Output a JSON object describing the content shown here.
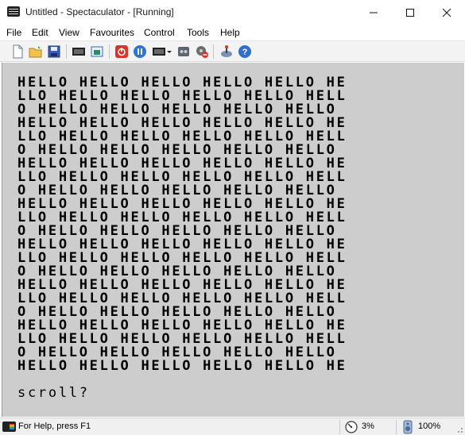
{
  "window": {
    "title": "Untitled - Spectaculator - [Running]"
  },
  "menu": [
    "File",
    "Edit",
    "View",
    "Favourites",
    "Control",
    "Tools",
    "Help"
  ],
  "toolbar": {
    "buttons": [
      {
        "name": "new-icon",
        "tooltip": ""
      },
      {
        "name": "open-folder-icon",
        "tooltip": ""
      },
      {
        "name": "save-icon",
        "tooltip": ""
      },
      {
        "name": "keyboard-icon",
        "tooltip": ""
      },
      {
        "name": "fullscreen-icon",
        "tooltip": ""
      },
      {
        "name": "power-icon",
        "tooltip": ""
      },
      {
        "name": "pause-icon",
        "tooltip": ""
      },
      {
        "name": "keyboard-dropdown-icon",
        "tooltip": ""
      },
      {
        "name": "tape-icon",
        "tooltip": ""
      },
      {
        "name": "disk-block-icon",
        "tooltip": ""
      },
      {
        "name": "joystick-icon",
        "tooltip": ""
      },
      {
        "name": "help-icon",
        "tooltip": ""
      }
    ]
  },
  "screen": {
    "lines": [
      "HELLO HELLO HELLO HELLO HELLO HE",
      "LLO HELLO HELLO HELLO HELLO HELL",
      "O HELLO HELLO HELLO HELLO HELLO ",
      "HELLO HELLO HELLO HELLO HELLO HE",
      "LLO HELLO HELLO HELLO HELLO HELL",
      "O HELLO HELLO HELLO HELLO HELLO ",
      "HELLO HELLO HELLO HELLO HELLO HE",
      "LLO HELLO HELLO HELLO HELLO HELL",
      "O HELLO HELLO HELLO HELLO HELLO ",
      "HELLO HELLO HELLO HELLO HELLO HE",
      "LLO HELLO HELLO HELLO HELLO HELL",
      "O HELLO HELLO HELLO HELLO HELLO ",
      "HELLO HELLO HELLO HELLO HELLO HE",
      "LLO HELLO HELLO HELLO HELLO HELL",
      "O HELLO HELLO HELLO HELLO HELLO ",
      "HELLO HELLO HELLO HELLO HELLO HE",
      "LLO HELLO HELLO HELLO HELLO HELL",
      "O HELLO HELLO HELLO HELLO HELLO ",
      "HELLO HELLO HELLO HELLO HELLO HE",
      "LLO HELLO HELLO HELLO HELLO HELL",
      "O HELLO HELLO HELLO HELLO HELLO ",
      "HELLO HELLO HELLO HELLO HELLO HE"
    ],
    "prompt": "scroll?",
    "background": "#cdcdcd",
    "ink": "#000000"
  },
  "status": {
    "help_text": "For Help, press F1",
    "speed": "3%",
    "volume": "100%"
  }
}
